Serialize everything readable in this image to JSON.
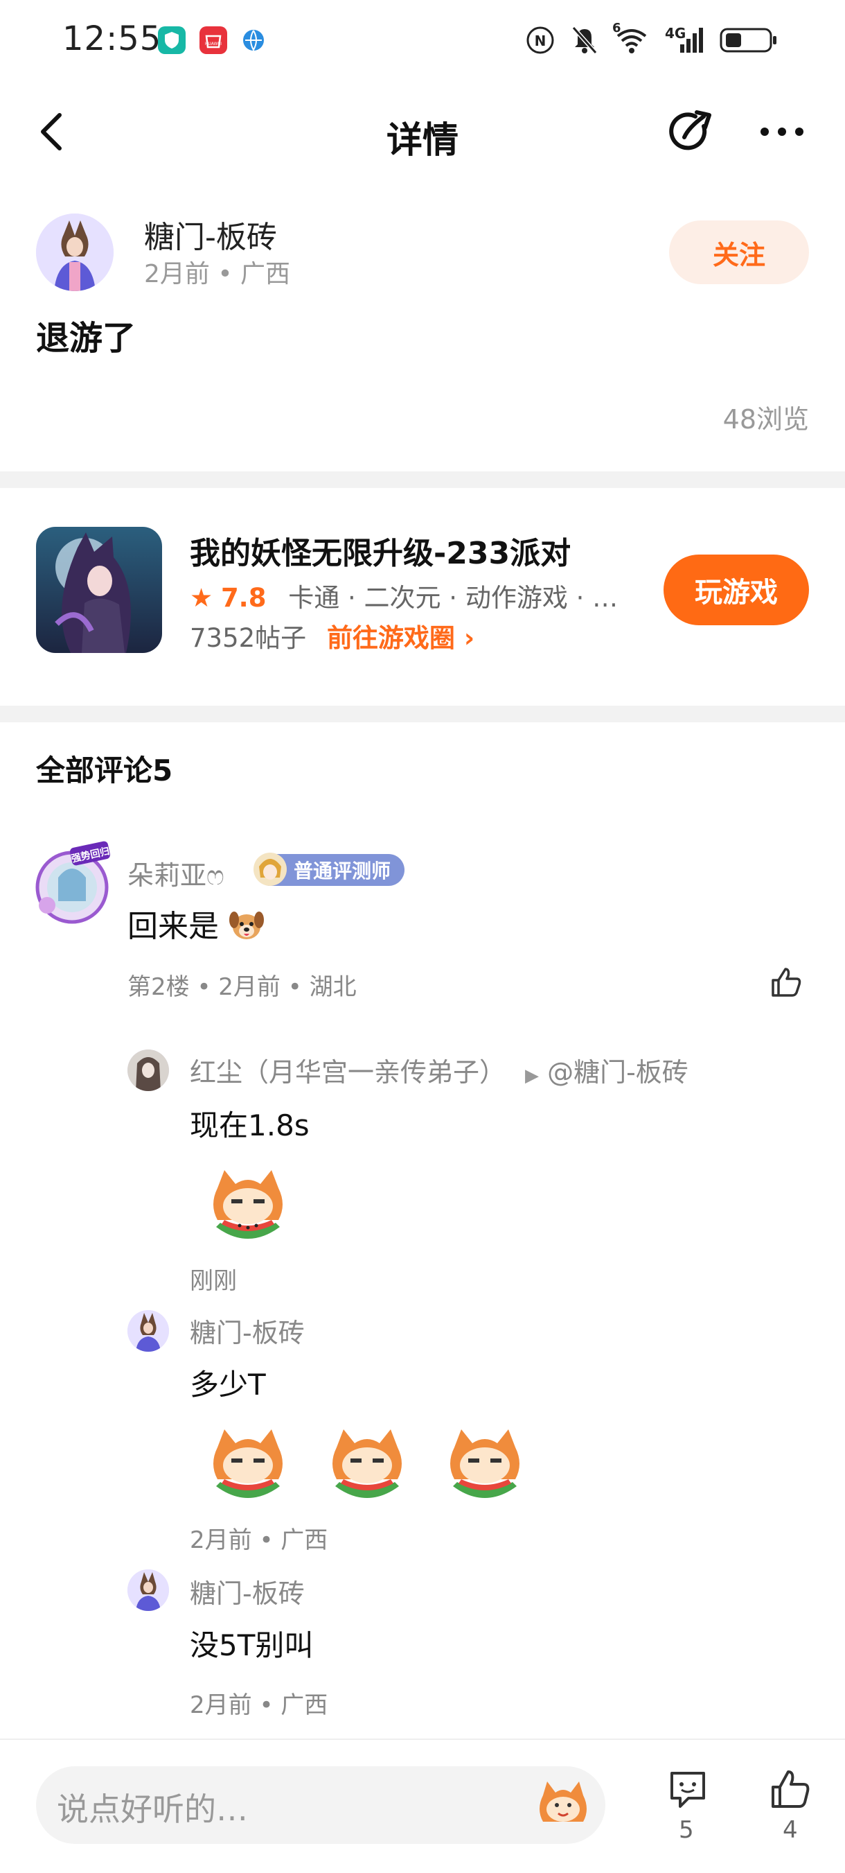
{
  "status_bar": {
    "time": "12:55",
    "icons": [
      "shield-app-icon",
      "huawei-app-icon",
      "globe-app-icon",
      "hd-icon",
      "mute-icon",
      "wifi-icon",
      "signal-4g-icon",
      "battery-icon"
    ],
    "wifi_label": "6",
    "signal_label": "4G",
    "huawei_label": "HUAWEI"
  },
  "header": {
    "title": "详情"
  },
  "post": {
    "author": "糖门-板砖",
    "meta": "2月前 • 广西",
    "follow_label": "关注",
    "text": "退游了",
    "views": "48浏览"
  },
  "game": {
    "title": "我的妖怪无限升级-233派对",
    "rating": "7.8",
    "tags": "卡通 · 二次元 · 动作游戏 · …",
    "posts": "7352帖子",
    "goto_label": "前往游戏圈",
    "play_label": "玩游戏"
  },
  "comments": {
    "heading": "全部评论5",
    "main": {
      "name": "朵莉亚ෆ",
      "badge": "普通评测师",
      "text": "回来是",
      "meta": "第2楼 • 2月前 • 湖北",
      "avatar_tag": "强势回归"
    },
    "replies": [
      {
        "name": "红尘（月华宫一亲传弟子）",
        "reply_to": "@糖门-板砖",
        "text": "现在1.8s",
        "stickers": 1,
        "meta": "刚刚"
      },
      {
        "name": "糖门-板砖",
        "text": "多少T",
        "stickers": 3,
        "meta": "2月前 • 广西"
      },
      {
        "name": "糖门-板砖",
        "text": "没5T别叫",
        "stickers": 0,
        "meta": "2月前 • 广西"
      }
    ]
  },
  "bottom_bar": {
    "input_placeholder": "说点好听的…",
    "comment_count": "5",
    "like_count": "4"
  },
  "colors": {
    "accent": "#ff6a14",
    "follow_bg": "#fdeee6",
    "badge_bg": "#8094d8",
    "divider": "#f2f2f2"
  }
}
